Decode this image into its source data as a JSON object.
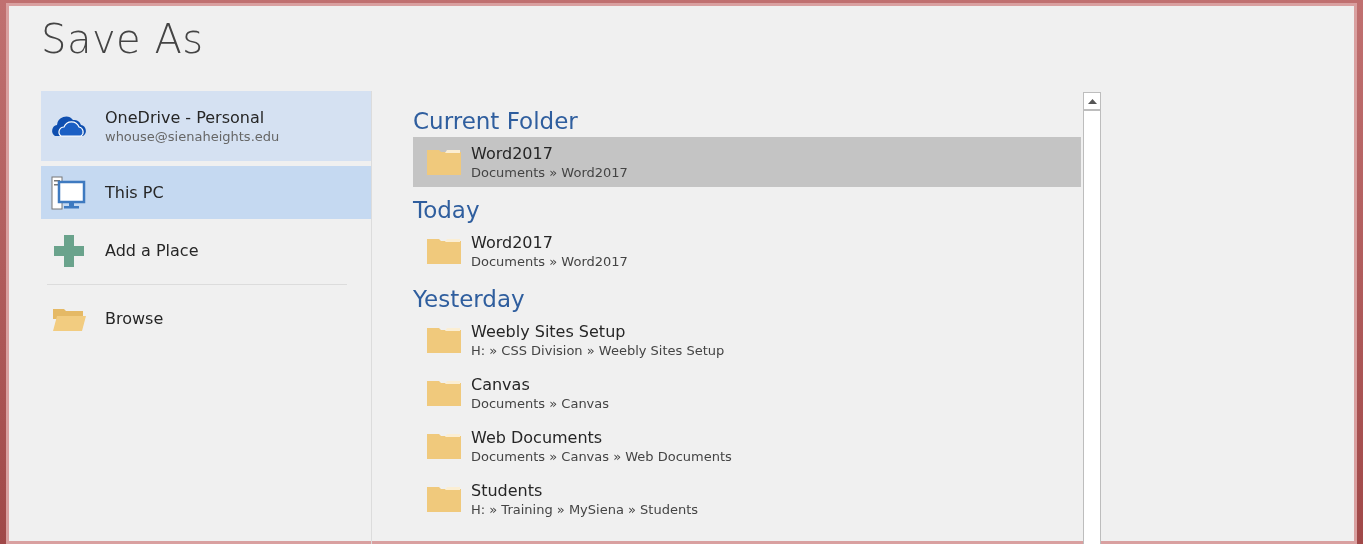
{
  "title": "Save As",
  "places": [
    {
      "kind": "cloud",
      "label": "OneDrive - Personal",
      "sublabel": "whouse@sienaheights.edu",
      "selected": false,
      "hovered": true
    },
    {
      "kind": "pc",
      "label": "This PC",
      "selected": true,
      "hovered": false
    },
    {
      "kind": "add",
      "label": "Add a Place",
      "selected": false,
      "hovered": false
    },
    {
      "kind": "browse",
      "label": "Browse",
      "selected": false,
      "hovered": false
    }
  ],
  "groups": [
    {
      "heading": "Current Folder",
      "folders": [
        {
          "name": "Word2017",
          "path": "Documents » Word2017",
          "selected": true
        }
      ]
    },
    {
      "heading": "Today",
      "folders": [
        {
          "name": "Word2017",
          "path": "Documents » Word2017",
          "selected": false
        }
      ]
    },
    {
      "heading": "Yesterday",
      "folders": [
        {
          "name": "Weebly Sites Setup",
          "path": "H: » CSS Division » Weebly Sites Setup",
          "selected": false
        },
        {
          "name": "Canvas",
          "path": "Documents » Canvas",
          "selected": false
        },
        {
          "name": "Web Documents",
          "path": "Documents » Canvas » Web Documents",
          "selected": false
        },
        {
          "name": "Students",
          "path": "H: » Training » MySiena » Students",
          "selected": false
        }
      ]
    }
  ]
}
